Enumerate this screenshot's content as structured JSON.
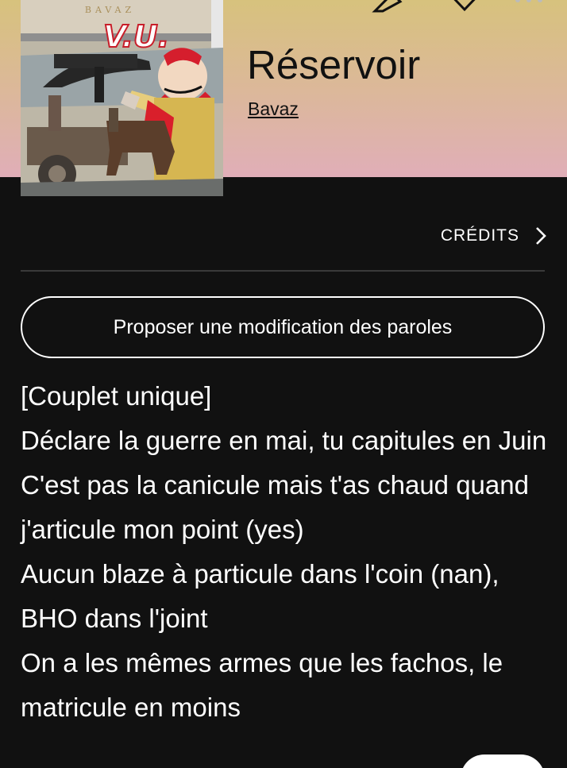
{
  "header": {
    "back_icon": "chevron-left-icon",
    "edit_icon": "pencil-icon",
    "favorite_icon": "heart-icon",
    "more_icon": "more-icon",
    "gradient_top": "#d7c27d",
    "gradient_bottom": "#e0aeb8"
  },
  "cover": {
    "artist_text": "BAVAZ",
    "logo_text": "V.U."
  },
  "song": {
    "title": "Réservoir",
    "artist": "Bavaz"
  },
  "credits": {
    "label": "CRÉDITS",
    "icon": "chevron-right-icon"
  },
  "suggest_button": {
    "label": "Proposer une modification des paroles"
  },
  "lyrics": [
    "[Couplet unique]",
    "Déclare la guerre en mai, tu capitules en Juin",
    "C'est pas la canicule mais t'as chaud quand j'articule mon point (yes)",
    "Aucun blaze à particule dans l'coin (nan), BHO dans l'joint",
    "On a les mêmes armes que les fachos, le matricule en moins"
  ],
  "colors": {
    "background": "#111111",
    "text": "#ffffff",
    "title": "#111111"
  }
}
